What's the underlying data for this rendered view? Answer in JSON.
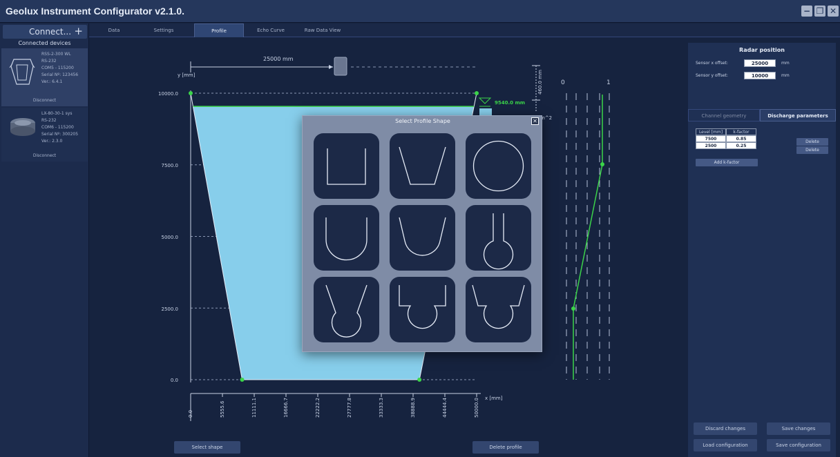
{
  "app": {
    "title": "Geolux Instrument Configurator v2.1.0.",
    "minimize": "−",
    "maximize": "❐",
    "close": "✕"
  },
  "sidebar": {
    "connect_label": "Connect...",
    "connect_plus": "+",
    "section_title": "Connected devices",
    "devices": [
      {
        "name": "RSS-2-300 WL",
        "interface": "RS-232",
        "port": "COM5 - 115200",
        "serial": "Serial Nº: 123456",
        "version": "Ver.: 6.4.1",
        "disconnect": "Disconnect"
      },
      {
        "name": "LX-80-30-1 sys",
        "interface": "RS-232",
        "port": "COM6 - 115200",
        "serial": "Serial Nº: 300205",
        "version": "Ver.: 2.3.0",
        "disconnect": "Disconnect"
      }
    ]
  },
  "tabs": [
    "Data",
    "Settings",
    "Profile",
    "Echo Curve",
    "Raw Data View"
  ],
  "active_tab": "Profile",
  "chart": {
    "y_axis_label": "y [mm]",
    "x_axis_label": "x [mm]",
    "y_ticks": [
      "10000.0",
      "7500.0",
      "5000.0",
      "2500.0",
      "0.0"
    ],
    "x_ticks": [
      "0.0",
      "5555.6",
      "11111.1",
      "16666.7",
      "22222.2",
      "27777.8",
      "33333.3",
      "38888.9",
      "44444.4",
      "50000.0"
    ],
    "offset_label": "25000 mm",
    "level_label": "9540.0 mm",
    "height_label": "460.0 mm",
    "area_suffix": "m^2",
    "k_ticks": [
      "0",
      "1"
    ],
    "fill_color": "#87ceeb",
    "accent_green": "#3bd44a",
    "profile_points": [
      [
        0,
        10000
      ],
      [
        9000,
        0
      ],
      [
        40000,
        0
      ],
      [
        50000,
        10000
      ]
    ],
    "water_level": 9540,
    "select_shape": "Select shape",
    "delete_profile": "Delete profile"
  },
  "right_panel": {
    "radar_title": "Radar position",
    "x_offset_label": "Sensor x offset:",
    "x_offset_value": "25000",
    "y_offset_label": "Sensor y offset:",
    "y_offset_value": "10000",
    "unit": "mm",
    "tab_geometry": "Channel geometry",
    "tab_discharge": "Discharge parameters",
    "k_table": {
      "headers": [
        "Level [mm]",
        "k-factor"
      ],
      "rows": [
        [
          "7500",
          "0.85"
        ],
        [
          "2500",
          "0.25"
        ]
      ]
    },
    "delete_label": "Delete",
    "add_k_factor": "Add k-factor",
    "discard_changes": "Discard changes",
    "save_changes": "Save changes",
    "load_configuration": "Load configuration",
    "save_configuration": "Save configuration"
  },
  "modal": {
    "title": "Select Profile Shape",
    "close": "✕",
    "shapes": [
      "rectangular",
      "trapezoidal",
      "circular",
      "u-shaped",
      "u-shaped-sloped",
      "keyhole",
      "trapezoid-over-circle",
      "rectangle-over-circle",
      "trapezoid-box-over-circle"
    ]
  }
}
